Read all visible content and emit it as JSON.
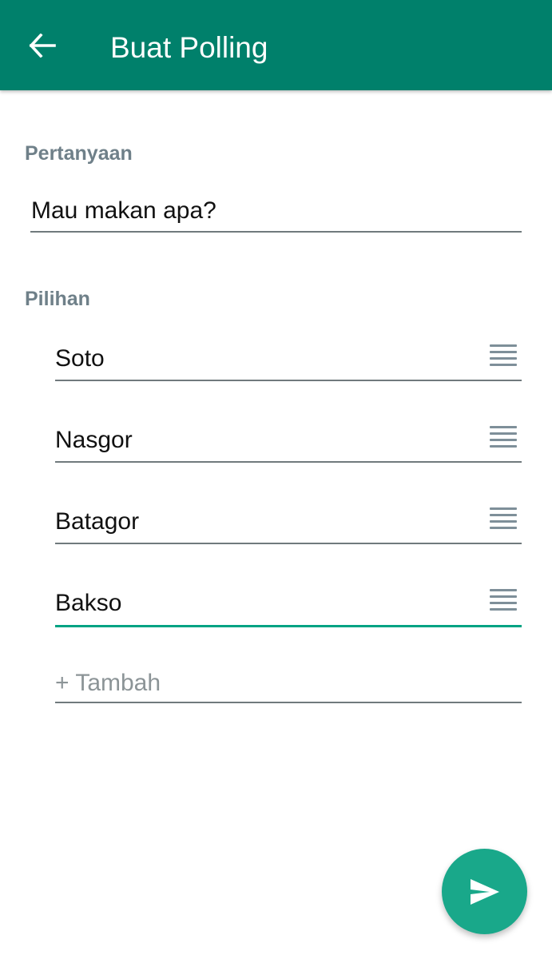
{
  "app_bar": {
    "title": "Buat Polling",
    "back_icon": "arrow-left-icon",
    "background_color": "#00806b"
  },
  "question": {
    "label": "Pertanyaan",
    "value": "Mau makan apa?"
  },
  "options": {
    "label": "Pilihan",
    "items": [
      {
        "value": "Soto"
      },
      {
        "value": "Nasgor"
      },
      {
        "value": "Batagor"
      },
      {
        "value": "Bakso"
      }
    ],
    "active_index": 3,
    "drag_icon": "drag-handle-icon",
    "add_placeholder": "+ Tambah"
  },
  "fab": {
    "icon": "send-icon",
    "color": "#19a88a"
  }
}
